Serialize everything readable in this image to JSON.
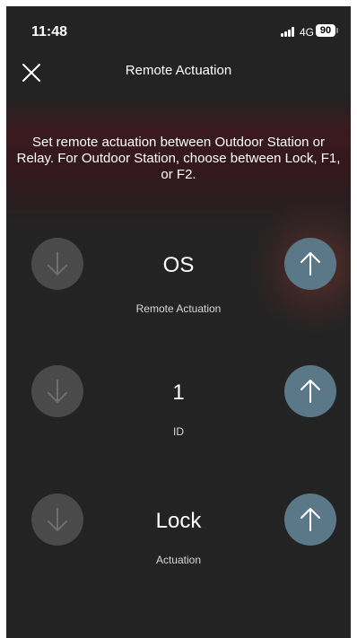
{
  "status_bar": {
    "time": "11:48",
    "network": "4G",
    "battery": "90"
  },
  "nav": {
    "title": "Remote Actuation"
  },
  "instructions": "Set remote actuation between Outdoor Station or Relay. For Outdoor Station, choose between Lock, F1, or F2.",
  "rows": [
    {
      "value": "OS",
      "label": "Remote Actuation"
    },
    {
      "value": "1",
      "label": "ID"
    },
    {
      "value": "Lock",
      "label": "Actuation"
    }
  ],
  "colors": {
    "background": "#232323",
    "up_button": "#5b7888",
    "down_button": "#4a4a4a",
    "accent_glow": "#3a1a20"
  },
  "icons": {
    "close": "close-icon",
    "decrement": "arrow-down-icon",
    "increment": "arrow-up-icon"
  }
}
